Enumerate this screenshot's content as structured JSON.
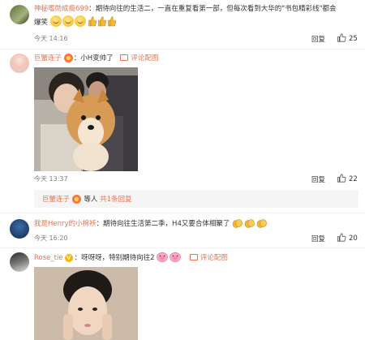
{
  "comments": [
    {
      "username": "神秘嗜勋成瘾699",
      "text_line1": "：期待向往的生活二，一直在重复看第一部，但每次看到大华的\"书包精彩线\"都会",
      "text_line2": "爆笑",
      "time": "今天 14:16",
      "reply_label": "回复",
      "likes": "25"
    },
    {
      "username": "巨蟹连子",
      "text": "：小H变帅了",
      "pic_label": "评论配图",
      "time": "今天 13:37",
      "reply_label": "回复",
      "likes": "22",
      "sub_username": "巨蟹连子",
      "sub_text": "等人",
      "sub_link": "共1条回复"
    },
    {
      "username": "我是Henry的小棉袄",
      "text": "：期待向往生活第二季，H4又要合体相聚了",
      "time": "今天 16:20",
      "reply_label": "回复",
      "likes": "20"
    },
    {
      "username": "Rose_tie",
      "text": "：呀呀呀，特别期待向往2",
      "pic_label": "评论配图"
    }
  ],
  "colors": {
    "link": "#eb7350",
    "muted": "#808080",
    "text": "#333333"
  },
  "icons": {
    "like": "thumbs-up-icon",
    "picture": "image-icon",
    "emoji_smile": "grinning-emoji",
    "emoji_thumb": "thumbs-up-emoji",
    "emoji_clap": "clap-emoji",
    "emoji_pig": "pig-emoji"
  }
}
